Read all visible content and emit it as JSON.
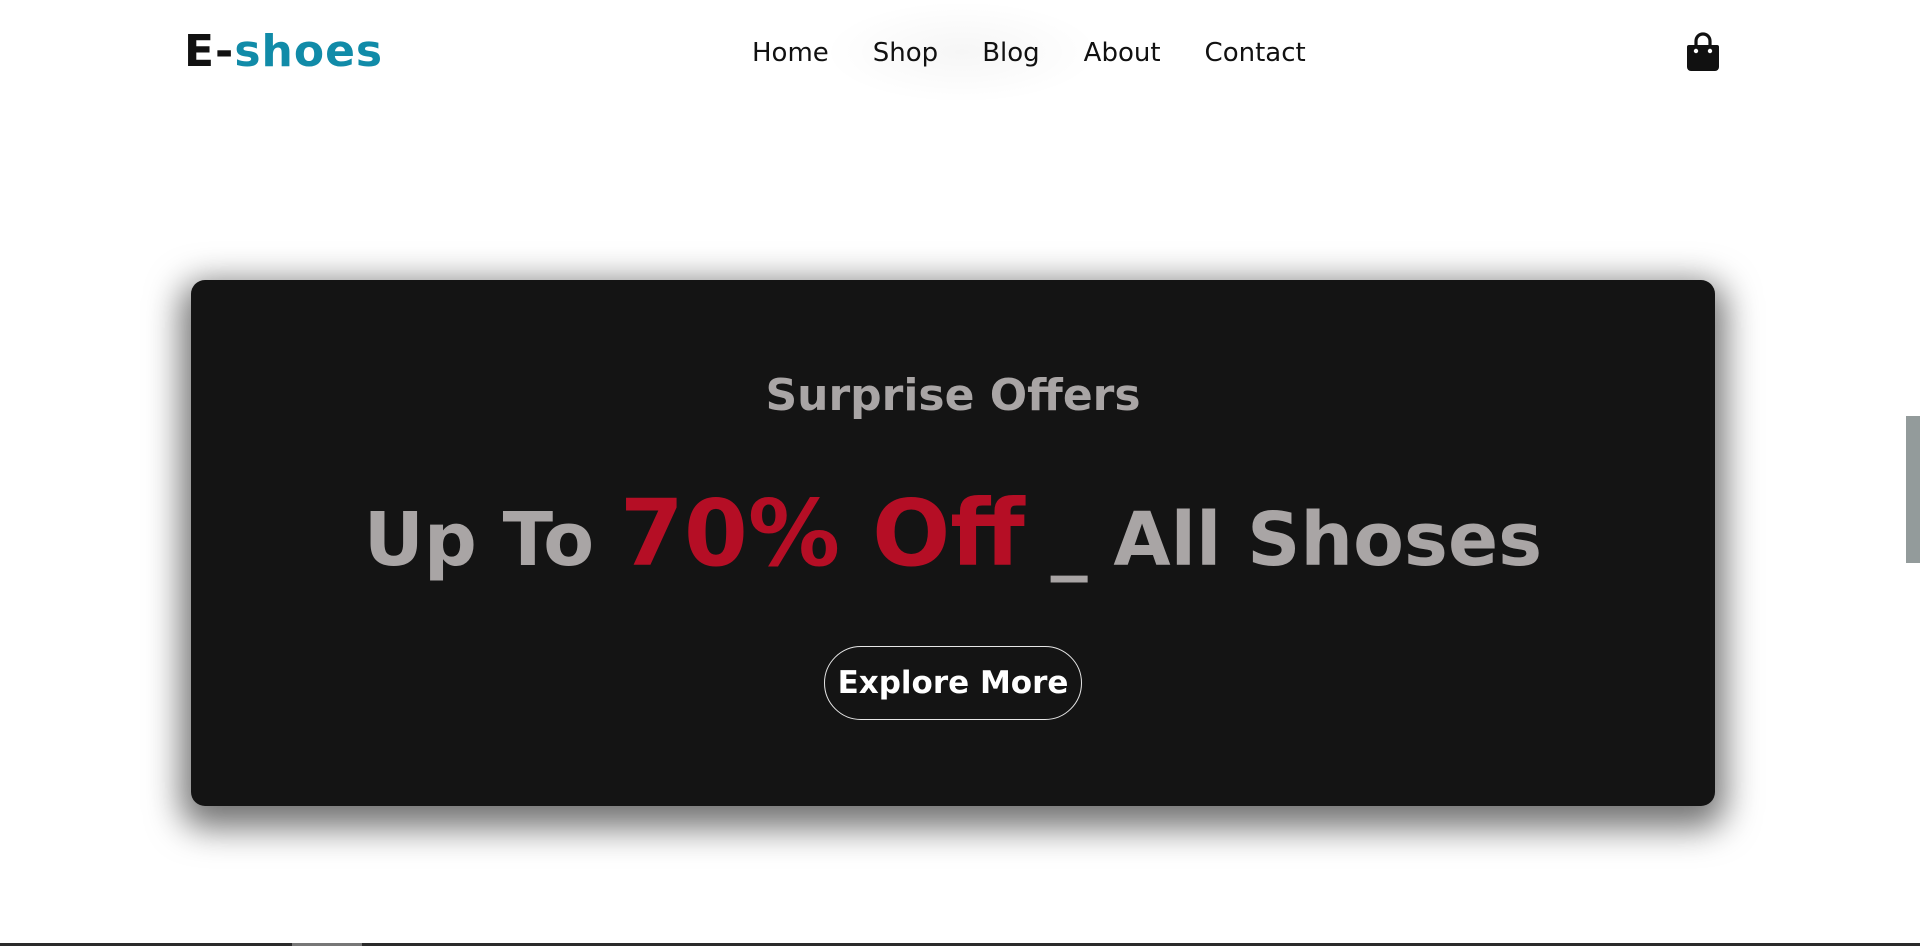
{
  "header": {
    "logo": {
      "prefix": "E-",
      "accent": "shoes"
    },
    "nav": [
      {
        "label": "Home"
      },
      {
        "label": "Shop"
      },
      {
        "label": "Blog"
      },
      {
        "label": "About"
      },
      {
        "label": "Contact"
      }
    ],
    "cart_icon": "shopping-bag-icon"
  },
  "hero": {
    "subtitle": "Surprise Offers",
    "title_before": "Up To ",
    "title_highlight": "70% Off",
    "title_after": " _ All Shoses",
    "button_label": "Explore More"
  },
  "colors": {
    "logo_accent": "#118ba8",
    "hero_background": "#141414",
    "hero_text": "#a9a5a5",
    "highlight": "#b50e25",
    "side_tab": "#939b9b"
  }
}
